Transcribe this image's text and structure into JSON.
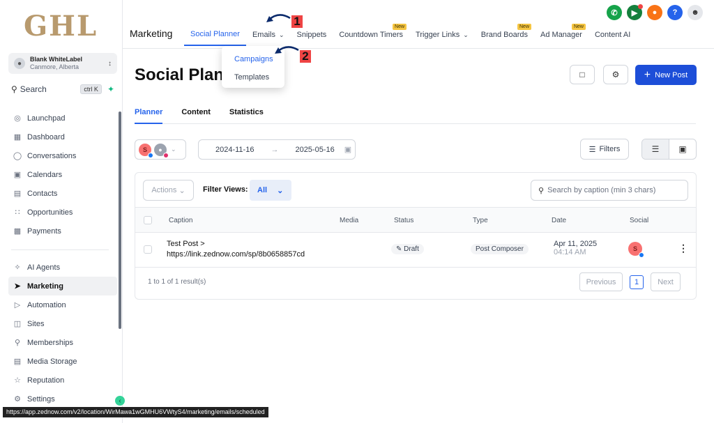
{
  "brand": {
    "logo_text": "GHL"
  },
  "account": {
    "name": "Blank WhiteLabel",
    "location": "Canmore, Alberta"
  },
  "sidebar": {
    "search_label": "Search",
    "search_shortcut": "ctrl K",
    "items": [
      {
        "label": "Launchpad",
        "icon": "rocket-icon"
      },
      {
        "label": "Dashboard",
        "icon": "grid-icon"
      },
      {
        "label": "Conversations",
        "icon": "chat-icon"
      },
      {
        "label": "Calendars",
        "icon": "calendar-icon"
      },
      {
        "label": "Contacts",
        "icon": "contacts-icon"
      },
      {
        "label": "Opportunities",
        "icon": "pipeline-icon"
      },
      {
        "label": "Payments",
        "icon": "payments-icon"
      }
    ],
    "items2": [
      {
        "label": "AI Agents",
        "icon": "sparkle-icon"
      },
      {
        "label": "Marketing",
        "icon": "send-icon",
        "active": true
      },
      {
        "label": "Automation",
        "icon": "automation-icon"
      },
      {
        "label": "Sites",
        "icon": "sites-icon"
      },
      {
        "label": "Memberships",
        "icon": "memberships-icon"
      },
      {
        "label": "Media Storage",
        "icon": "image-icon"
      },
      {
        "label": "Reputation",
        "icon": "star-icon"
      },
      {
        "label": "Settings",
        "icon": "gear-icon"
      }
    ]
  },
  "status_url": "https://app.zednow.com/v2/location/WirMawa1wGMHU6VWtyS4/marketing/emails/scheduled",
  "topbar": {
    "title": "Marketing",
    "tabs": [
      {
        "label": "Social Planner",
        "active": true
      },
      {
        "label": "Emails",
        "chevron": true
      },
      {
        "label": "Snippets"
      },
      {
        "label": "Countdown Timers",
        "badge": "New"
      },
      {
        "label": "Trigger Links",
        "chevron": true
      },
      {
        "label": "Brand Boards",
        "badge": "New"
      },
      {
        "label": "Ad Manager",
        "badge": "New"
      },
      {
        "label": "Content AI"
      }
    ]
  },
  "dropdown": {
    "items": [
      "Campaigns",
      "Templates"
    ]
  },
  "annotations": {
    "one": "1",
    "two": "2"
  },
  "page": {
    "title": "Social Planner",
    "new_post": "New Post",
    "subtabs": [
      "Planner",
      "Content",
      "Statistics"
    ],
    "date_start": "2024-11-16",
    "date_end": "2025-05-16",
    "filters": "Filters",
    "actions": "Actions",
    "filter_views_label": "Filter Views:",
    "filter_views_value": "All",
    "search_placeholder": "Search by caption (min 3 chars)",
    "columns": [
      "Caption",
      "Media",
      "Status",
      "Type",
      "Date",
      "Social"
    ],
    "rows": [
      {
        "caption_line1": "Test Post >",
        "caption_line2": "https://link.zednow.com/sp/8b0658857cd",
        "status": "Draft",
        "type": "Post Composer",
        "date": "Apr 11, 2025",
        "time": "04:14 AM",
        "avatar": "S"
      }
    ],
    "result_text": "1 to 1 of 1 result(s)",
    "previous": "Previous",
    "page_num": "1",
    "next": "Next"
  },
  "colors": {
    "accent": "#2563eb",
    "primary_button": "#1d4ed8",
    "logo": "#b89a6e"
  }
}
